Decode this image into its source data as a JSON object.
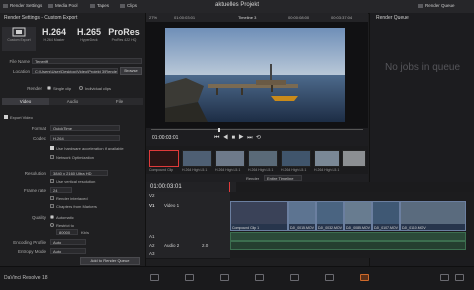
{
  "topbar": {
    "render_settings": "Render Settings",
    "media_pool": "Media Pool",
    "tapes": "Tapes",
    "clips": "Clips",
    "project_title": "aktuelles Projekt",
    "render_queue": "Render Queue"
  },
  "render_settings": {
    "title": "Render Settings - Custom Export",
    "formats": [
      {
        "big": "",
        "small": "Custom Export"
      },
      {
        "big": "H.264",
        "small": "H.264 Master"
      },
      {
        "big": "H.265",
        "small": "HyperDeck"
      },
      {
        "big": "ProRes",
        "small": "ProRes 422 HQ"
      }
    ],
    "file_name_label": "File Name",
    "file_name_value": "Teneriff",
    "location_label": "Location",
    "location_value": "C:\\Users\\User\\Desktop\\Video\\Projekt 3\\Render",
    "browse_button": "Browse",
    "render_label": "Render",
    "single_clip": "Single clip",
    "individual_clips": "Individual clips",
    "tabs": [
      "Video",
      "Audio",
      "File"
    ],
    "export_video": "Export Video",
    "format_label": "Format",
    "format_value": "QuickTime",
    "codec_label": "Codec",
    "codec_value": "H.264",
    "use_hw": "Use hardware acceleration if available",
    "network_opt": "Network Optimization",
    "resolution_label": "Resolution",
    "resolution_value": "3840 x 2160 Ultra HD",
    "vertical_res": "Use vertical resolution",
    "frame_rate_label": "Frame rate",
    "frame_rate_value": "24",
    "interlaced": "Render interlaced",
    "chapters": "Chapters from Markers",
    "quality_label": "Quality",
    "quality_auto": "Automatic",
    "restrict_to": "Restrict to",
    "restrict_value": "80000",
    "restrict_unit": "Kb/s",
    "encoding_profile_label": "Encoding Profile",
    "encoding_profile_value": "Auto",
    "entropy_mode_label": "Entropy Mode",
    "entropy_mode_value": "Auto",
    "add_to_queue": "Add to Render Queue"
  },
  "viewer": {
    "zoom": "27%",
    "timecode_left": "01:00:03:01",
    "timeline_name": "Timeline 3",
    "timecode_right": "00:00:08:00",
    "timecode_far": "00:03:37:04",
    "playhead_tc": "01:00:03:01"
  },
  "render_queue": {
    "title": "Render Queue",
    "empty_text": "No jobs in queue"
  },
  "clips": [
    {
      "id": "01",
      "label": "Compound Clip"
    },
    {
      "id": "02",
      "label": "H.264 High L5.1"
    },
    {
      "id": "03",
      "label": "H.264 High L5.1"
    },
    {
      "id": "04",
      "label": "H.264 High L5.1"
    },
    {
      "id": "05",
      "label": "H.264 High L5.1"
    },
    {
      "id": "06",
      "label": "H.264 High L5.1"
    },
    {
      "id": "07",
      "label": "H.264 High L5.1"
    },
    {
      "id": "08",
      "label": "H.264 High L5.1"
    }
  ],
  "timeline": {
    "render_label": "Render",
    "entire_timeline": "Entire Timeline",
    "timecode": "01:00:03:01",
    "v2_label": "V2",
    "v1_label": "V1",
    "video1_name": "Video 1",
    "a1_label": "A1",
    "a2_label": "A2",
    "audio2_name": "Audio 2",
    "a2_level": "2.0",
    "a3_label": "A3",
    "clip_labels": [
      "Compound Clip 1",
      "DJI_0015.MOV",
      "DJI_0032.MOV",
      "DJI_0085.MOV",
      "DJI_0107.MOV",
      "DJI_0110.MOV"
    ]
  },
  "statusbar": {
    "app_name": "DaVinci Resolve 18"
  },
  "colors": {
    "accent_orange": "#d06a2a",
    "selected_clip_border": "#e03a3a",
    "playhead_red": "#e03a3a"
  }
}
